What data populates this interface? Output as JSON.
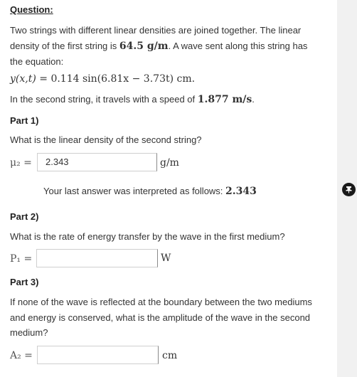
{
  "question": {
    "header": "Question:",
    "intro_text": "Two strings with different linear densities are joined together. The linear density of the first string is",
    "density_value": "64.5 g/m",
    "intro_text_2": ". A wave sent along this string has the equation:",
    "equation": {
      "lhs": "y(x,t) = ",
      "rhs": "0.114 sin(6.81x − 3.73t) cm."
    },
    "speed_text": "In the second string, it travels with a speed of",
    "speed_value": "1.877 m/s",
    "speed_end": "."
  },
  "parts": [
    {
      "title": "Part 1)",
      "prompt": "What is the linear density of the second string?",
      "label": "μ₂ =",
      "value": "2.343",
      "unit": "g/m",
      "feedback_text": "Your last answer was interpreted as follows:",
      "feedback_value": "2.343"
    },
    {
      "title": "Part 2)",
      "prompt": "What is the rate of energy transfer by the wave in the first medium?",
      "label": "P₁ =",
      "value": "",
      "unit": "W"
    },
    {
      "title": "Part 3)",
      "prompt": "If none of the wave is reflected at the boundary between the two mediums and energy is conserved, what is the amplitude of the wave in the second medium?",
      "label": "A₂ =",
      "value": "",
      "unit": "cm"
    }
  ],
  "icons": {
    "pin": "pin-icon"
  },
  "colors": {
    "text": "#333333",
    "rail": "#f1f1f1",
    "pin_bg": "#1a1a1a"
  }
}
